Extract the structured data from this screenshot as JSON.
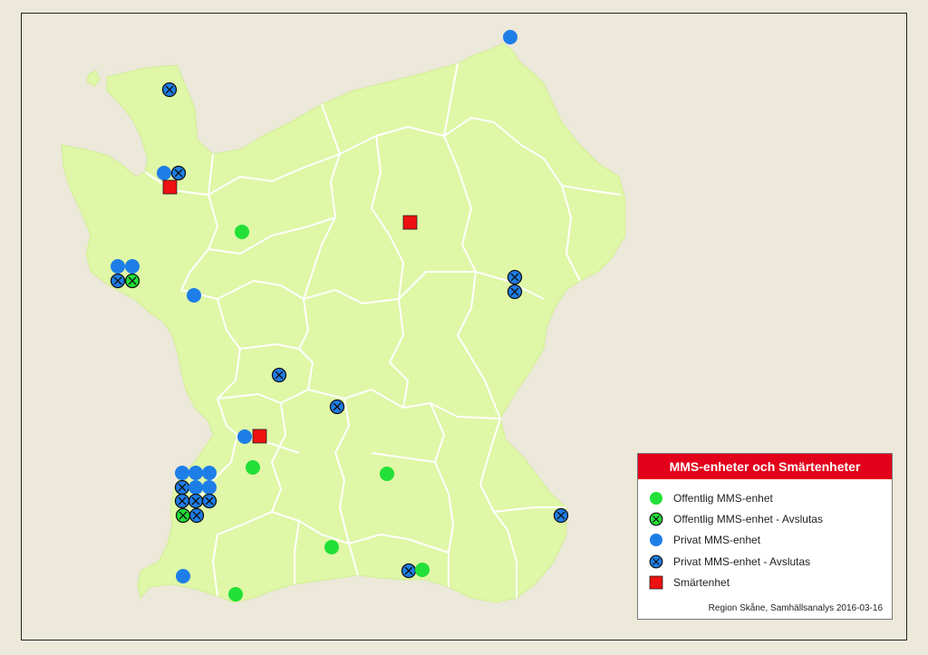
{
  "legend": {
    "title": "MMS-enheter och Smärtenheter",
    "items": [
      {
        "label": "Offentlig MMS-enhet",
        "symbol": "public-unit-icon"
      },
      {
        "label": "Offentlig MMS-enhet - Avslutas",
        "symbol": "public-unit-closing-icon"
      },
      {
        "label": "Privat MMS-enhet",
        "symbol": "private-unit-icon"
      },
      {
        "label": "Privat MMS-enhet - Avslutas",
        "symbol": "private-unit-closing-icon"
      },
      {
        "label": "Smärtenhet",
        "symbol": "pain-unit-icon"
      }
    ],
    "credit": "Region Skåne, Samhällsanalys 2016-03-16"
  },
  "colors": {
    "background": "#ece8da",
    "land": "#dff7a7",
    "borders": "#ffffff",
    "public_unit": "#22e037",
    "private_unit": "#1e7ee8",
    "pain_unit": "#ee1111",
    "legend_header": "#e3001b"
  }
}
